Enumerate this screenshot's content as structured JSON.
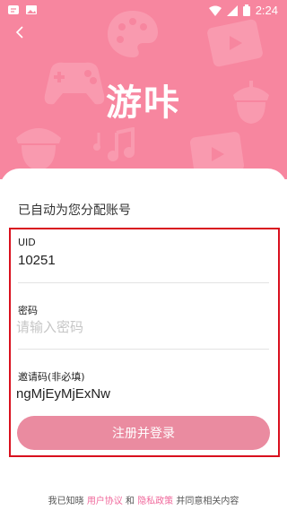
{
  "status_bar": {
    "time": "2:24"
  },
  "header": {
    "title": "游咔"
  },
  "form": {
    "subtitle": "已自动为您分配账号",
    "uid": {
      "label": "UID",
      "value": "10251"
    },
    "password": {
      "label": "密码",
      "placeholder": "请输入密码"
    },
    "invite": {
      "label": "邀请码(非必填)",
      "value": "ngMjEyMjExNw"
    },
    "register_label": "注册并登录"
  },
  "footer": {
    "prefix": "我已知晓",
    "user_agreement": "用户协议",
    "and": "和",
    "privacy_policy": "隐私政策",
    "suffix": "并同意相关内容"
  },
  "colors": {
    "brand": "#f7869f",
    "button": "#ea8ba0",
    "link": "#f0689b",
    "highlight_border": "#d9101e"
  }
}
